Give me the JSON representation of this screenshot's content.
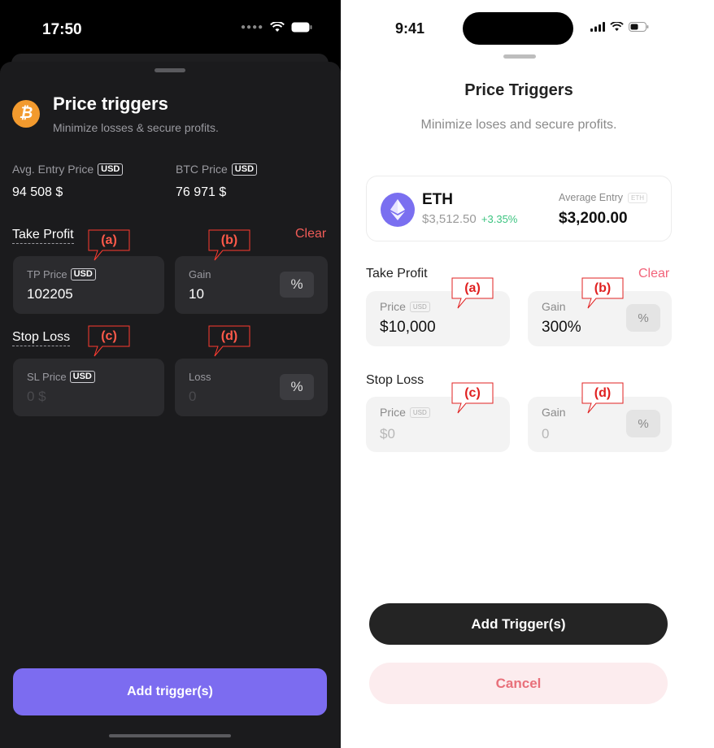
{
  "left_screen": {
    "status_time": "17:50",
    "title": "Price triggers",
    "subtitle": "Minimize losses & secure profits.",
    "avg_entry_label": "Avg. Entry Price",
    "avg_entry_badge": "USD",
    "avg_entry_value": "94 508 $",
    "btc_price_label": "BTC Price",
    "btc_price_badge": "USD",
    "btc_price_value": "76 971 $",
    "take_profit_label": "Take Profit",
    "clear_label": "Clear",
    "tp_price_label": "TP Price",
    "tp_price_badge": "USD",
    "tp_price_value": "102205",
    "gain_label": "Gain",
    "gain_value": "10",
    "percent_symbol": "%",
    "stop_loss_label": "Stop Loss",
    "sl_price_label": "SL Price",
    "sl_price_badge": "USD",
    "sl_price_placeholder": "0 $",
    "loss_label": "Loss",
    "loss_placeholder": "0",
    "add_button": "Add trigger(s)"
  },
  "right_screen": {
    "status_time": "9:41",
    "title": "Price Triggers",
    "subtitle": "Minimize loses and secure profits.",
    "asset_name": "ETH",
    "asset_price": "$3,512.50",
    "asset_change": "+3.35%",
    "avg_entry_label": "Average Entry",
    "avg_entry_badge": "ETH",
    "avg_entry_value": "$3,200.00",
    "take_profit_label": "Take Profit",
    "clear_label": "Clear",
    "tp_price_label": "Price",
    "tp_price_badge": "USD",
    "tp_price_value": "$10,000",
    "tp_gain_label": "Gain",
    "tp_gain_value": "300%",
    "percent_symbol": "%",
    "stop_loss_label": "Stop Loss",
    "sl_price_label": "Price",
    "sl_price_badge": "USD",
    "sl_price_placeholder": "$0",
    "sl_gain_label": "Gain",
    "sl_gain_placeholder": "0",
    "add_button": "Add Trigger(s)",
    "cancel_button": "Cancel"
  },
  "callouts": {
    "a": "(a)",
    "b": "(b)",
    "c": "(c)",
    "d": "(d)"
  },
  "colors": {
    "left_accent": "#7c6cf0",
    "left_clear": "#ef5b57",
    "right_clear": "#f2637a",
    "right_positive": "#3cc480",
    "callout_red": "#e02020"
  }
}
